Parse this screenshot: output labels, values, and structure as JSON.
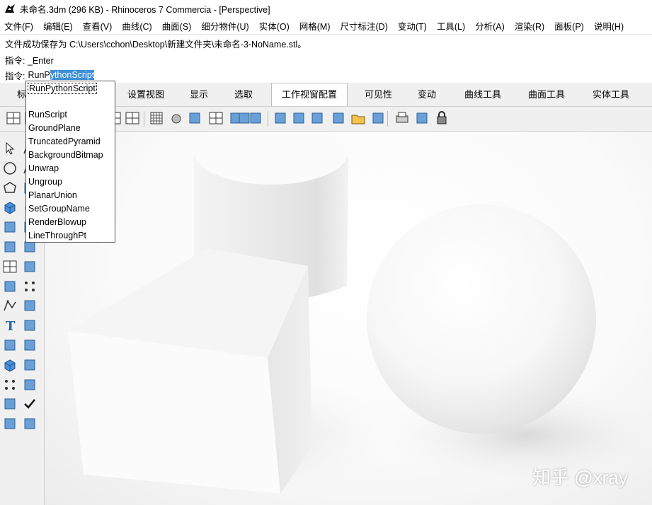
{
  "window": {
    "title": "未命名.3dm (296 KB) - Rhinoceros 7 Commercia - [Perspective]"
  },
  "menu": [
    "文件(F)",
    "编辑(E)",
    "查看(V)",
    "曲线(C)",
    "曲面(S)",
    "细分物件(U)",
    "实体(O)",
    "网格(M)",
    "尺寸标注(D)",
    "变动(T)",
    "工具(L)",
    "分析(A)",
    "渲染(R)",
    "面板(P)",
    "说明(H)"
  ],
  "command_history": [
    "文件成功保存为 C:\\Users\\cchon\\Desktop\\新建文件夹\\未命名-3-NoName.stl。",
    "指令: _Enter"
  ],
  "command_prompt": {
    "label": "指令:",
    "typed": "RunP",
    "autocomplete": "ythonScript"
  },
  "tabs": [
    {
      "label": "标",
      "active": false
    },
    {
      "label": "设置视图",
      "active": false
    },
    {
      "label": "显示",
      "active": false
    },
    {
      "label": "选取",
      "active": false
    },
    {
      "label": "工作视窗配置",
      "active": true
    },
    {
      "label": "可见性",
      "active": false
    },
    {
      "label": "变动",
      "active": false
    },
    {
      "label": "曲线工具",
      "active": false
    },
    {
      "label": "曲面工具",
      "active": false
    },
    {
      "label": "实体工具",
      "active": false
    }
  ],
  "autocomplete_list": [
    {
      "label": "RunPythonScript",
      "selected": true
    },
    {
      "label": "RunScript",
      "selected": false
    },
    {
      "label": "GroundPlane",
      "selected": false
    },
    {
      "label": "TruncatedPyramid",
      "selected": false
    },
    {
      "label": "BackgroundBitmap",
      "selected": false
    },
    {
      "label": "Unwrap",
      "selected": false
    },
    {
      "label": "Ungroup",
      "selected": false
    },
    {
      "label": "PlanarUnion",
      "selected": false
    },
    {
      "label": "SetGroupName",
      "selected": false
    },
    {
      "label": "RenderBlowup",
      "selected": false
    },
    {
      "label": "LineThroughPt",
      "selected": false
    }
  ],
  "toolbar_icons": [
    "four-viewports-icon",
    "split-viewport-icon",
    "split-horizontal-icon",
    "split-vertical-icon",
    "grid-icon",
    "point-light-icon",
    "two-point-perspective-icon",
    "viewport-properties-icon",
    "capture-icon",
    "lens-icon",
    "render-color-icon",
    "new-layout-icon",
    "detail-view-icon",
    "enable-detail-icon",
    "ground-plane-icon",
    "open-folder-icon",
    "snapshot-icon",
    "print-icon",
    "save-info-icon",
    "lock-icon"
  ],
  "left_toolbar_icons": [
    "select-arrow-icon",
    "polyline-icon",
    "circle-icon",
    "curve-icon",
    "polygon-icon",
    "surface-corner-icon",
    "box-icon",
    "sphere-icon",
    "extrude-icon",
    "mesh-icon",
    "subd-icon",
    "boolean-union-icon",
    "split-icon",
    "trim-icon",
    "boolean-icon",
    "points-icon",
    "fillet-icon",
    "offset-icon",
    "text-icon",
    "scale-icon",
    "group-icon",
    "mirror-icon",
    "solid-box-icon",
    "dimension-icon",
    "array-icon",
    "align-icon",
    "flow-icon",
    "check-icon",
    "render-icon",
    "material-icon"
  ],
  "watermark": "知乎 @xray",
  "colors": {
    "selection_highlight": "#3d8fd6",
    "toolbar_bg": "#f0f0f0"
  }
}
